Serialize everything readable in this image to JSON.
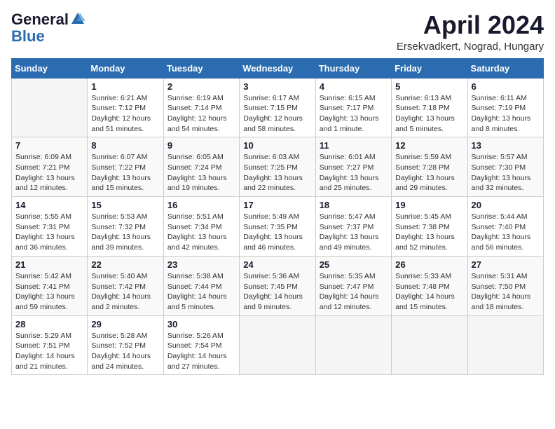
{
  "logo": {
    "general": "General",
    "blue": "Blue"
  },
  "title": "April 2024",
  "location": "Ersekvadkert, Nograd, Hungary",
  "days_of_week": [
    "Sunday",
    "Monday",
    "Tuesday",
    "Wednesday",
    "Thursday",
    "Friday",
    "Saturday"
  ],
  "weeks": [
    [
      {
        "day": "",
        "sunrise": "",
        "sunset": "",
        "daylight": ""
      },
      {
        "day": "1",
        "sunrise": "Sunrise: 6:21 AM",
        "sunset": "Sunset: 7:12 PM",
        "daylight": "Daylight: 12 hours and 51 minutes."
      },
      {
        "day": "2",
        "sunrise": "Sunrise: 6:19 AM",
        "sunset": "Sunset: 7:14 PM",
        "daylight": "Daylight: 12 hours and 54 minutes."
      },
      {
        "day": "3",
        "sunrise": "Sunrise: 6:17 AM",
        "sunset": "Sunset: 7:15 PM",
        "daylight": "Daylight: 12 hours and 58 minutes."
      },
      {
        "day": "4",
        "sunrise": "Sunrise: 6:15 AM",
        "sunset": "Sunset: 7:17 PM",
        "daylight": "Daylight: 13 hours and 1 minute."
      },
      {
        "day": "5",
        "sunrise": "Sunrise: 6:13 AM",
        "sunset": "Sunset: 7:18 PM",
        "daylight": "Daylight: 13 hours and 5 minutes."
      },
      {
        "day": "6",
        "sunrise": "Sunrise: 6:11 AM",
        "sunset": "Sunset: 7:19 PM",
        "daylight": "Daylight: 13 hours and 8 minutes."
      }
    ],
    [
      {
        "day": "7",
        "sunrise": "Sunrise: 6:09 AM",
        "sunset": "Sunset: 7:21 PM",
        "daylight": "Daylight: 13 hours and 12 minutes."
      },
      {
        "day": "8",
        "sunrise": "Sunrise: 6:07 AM",
        "sunset": "Sunset: 7:22 PM",
        "daylight": "Daylight: 13 hours and 15 minutes."
      },
      {
        "day": "9",
        "sunrise": "Sunrise: 6:05 AM",
        "sunset": "Sunset: 7:24 PM",
        "daylight": "Daylight: 13 hours and 19 minutes."
      },
      {
        "day": "10",
        "sunrise": "Sunrise: 6:03 AM",
        "sunset": "Sunset: 7:25 PM",
        "daylight": "Daylight: 13 hours and 22 minutes."
      },
      {
        "day": "11",
        "sunrise": "Sunrise: 6:01 AM",
        "sunset": "Sunset: 7:27 PM",
        "daylight": "Daylight: 13 hours and 25 minutes."
      },
      {
        "day": "12",
        "sunrise": "Sunrise: 5:59 AM",
        "sunset": "Sunset: 7:28 PM",
        "daylight": "Daylight: 13 hours and 29 minutes."
      },
      {
        "day": "13",
        "sunrise": "Sunrise: 5:57 AM",
        "sunset": "Sunset: 7:30 PM",
        "daylight": "Daylight: 13 hours and 32 minutes."
      }
    ],
    [
      {
        "day": "14",
        "sunrise": "Sunrise: 5:55 AM",
        "sunset": "Sunset: 7:31 PM",
        "daylight": "Daylight: 13 hours and 36 minutes."
      },
      {
        "day": "15",
        "sunrise": "Sunrise: 5:53 AM",
        "sunset": "Sunset: 7:32 PM",
        "daylight": "Daylight: 13 hours and 39 minutes."
      },
      {
        "day": "16",
        "sunrise": "Sunrise: 5:51 AM",
        "sunset": "Sunset: 7:34 PM",
        "daylight": "Daylight: 13 hours and 42 minutes."
      },
      {
        "day": "17",
        "sunrise": "Sunrise: 5:49 AM",
        "sunset": "Sunset: 7:35 PM",
        "daylight": "Daylight: 13 hours and 46 minutes."
      },
      {
        "day": "18",
        "sunrise": "Sunrise: 5:47 AM",
        "sunset": "Sunset: 7:37 PM",
        "daylight": "Daylight: 13 hours and 49 minutes."
      },
      {
        "day": "19",
        "sunrise": "Sunrise: 5:45 AM",
        "sunset": "Sunset: 7:38 PM",
        "daylight": "Daylight: 13 hours and 52 minutes."
      },
      {
        "day": "20",
        "sunrise": "Sunrise: 5:44 AM",
        "sunset": "Sunset: 7:40 PM",
        "daylight": "Daylight: 13 hours and 56 minutes."
      }
    ],
    [
      {
        "day": "21",
        "sunrise": "Sunrise: 5:42 AM",
        "sunset": "Sunset: 7:41 PM",
        "daylight": "Daylight: 13 hours and 59 minutes."
      },
      {
        "day": "22",
        "sunrise": "Sunrise: 5:40 AM",
        "sunset": "Sunset: 7:42 PM",
        "daylight": "Daylight: 14 hours and 2 minutes."
      },
      {
        "day": "23",
        "sunrise": "Sunrise: 5:38 AM",
        "sunset": "Sunset: 7:44 PM",
        "daylight": "Daylight: 14 hours and 5 minutes."
      },
      {
        "day": "24",
        "sunrise": "Sunrise: 5:36 AM",
        "sunset": "Sunset: 7:45 PM",
        "daylight": "Daylight: 14 hours and 9 minutes."
      },
      {
        "day": "25",
        "sunrise": "Sunrise: 5:35 AM",
        "sunset": "Sunset: 7:47 PM",
        "daylight": "Daylight: 14 hours and 12 minutes."
      },
      {
        "day": "26",
        "sunrise": "Sunrise: 5:33 AM",
        "sunset": "Sunset: 7:48 PM",
        "daylight": "Daylight: 14 hours and 15 minutes."
      },
      {
        "day": "27",
        "sunrise": "Sunrise: 5:31 AM",
        "sunset": "Sunset: 7:50 PM",
        "daylight": "Daylight: 14 hours and 18 minutes."
      }
    ],
    [
      {
        "day": "28",
        "sunrise": "Sunrise: 5:29 AM",
        "sunset": "Sunset: 7:51 PM",
        "daylight": "Daylight: 14 hours and 21 minutes."
      },
      {
        "day": "29",
        "sunrise": "Sunrise: 5:28 AM",
        "sunset": "Sunset: 7:52 PM",
        "daylight": "Daylight: 14 hours and 24 minutes."
      },
      {
        "day": "30",
        "sunrise": "Sunrise: 5:26 AM",
        "sunset": "Sunset: 7:54 PM",
        "daylight": "Daylight: 14 hours and 27 minutes."
      },
      {
        "day": "",
        "sunrise": "",
        "sunset": "",
        "daylight": ""
      },
      {
        "day": "",
        "sunrise": "",
        "sunset": "",
        "daylight": ""
      },
      {
        "day": "",
        "sunrise": "",
        "sunset": "",
        "daylight": ""
      },
      {
        "day": "",
        "sunrise": "",
        "sunset": "",
        "daylight": ""
      }
    ]
  ]
}
